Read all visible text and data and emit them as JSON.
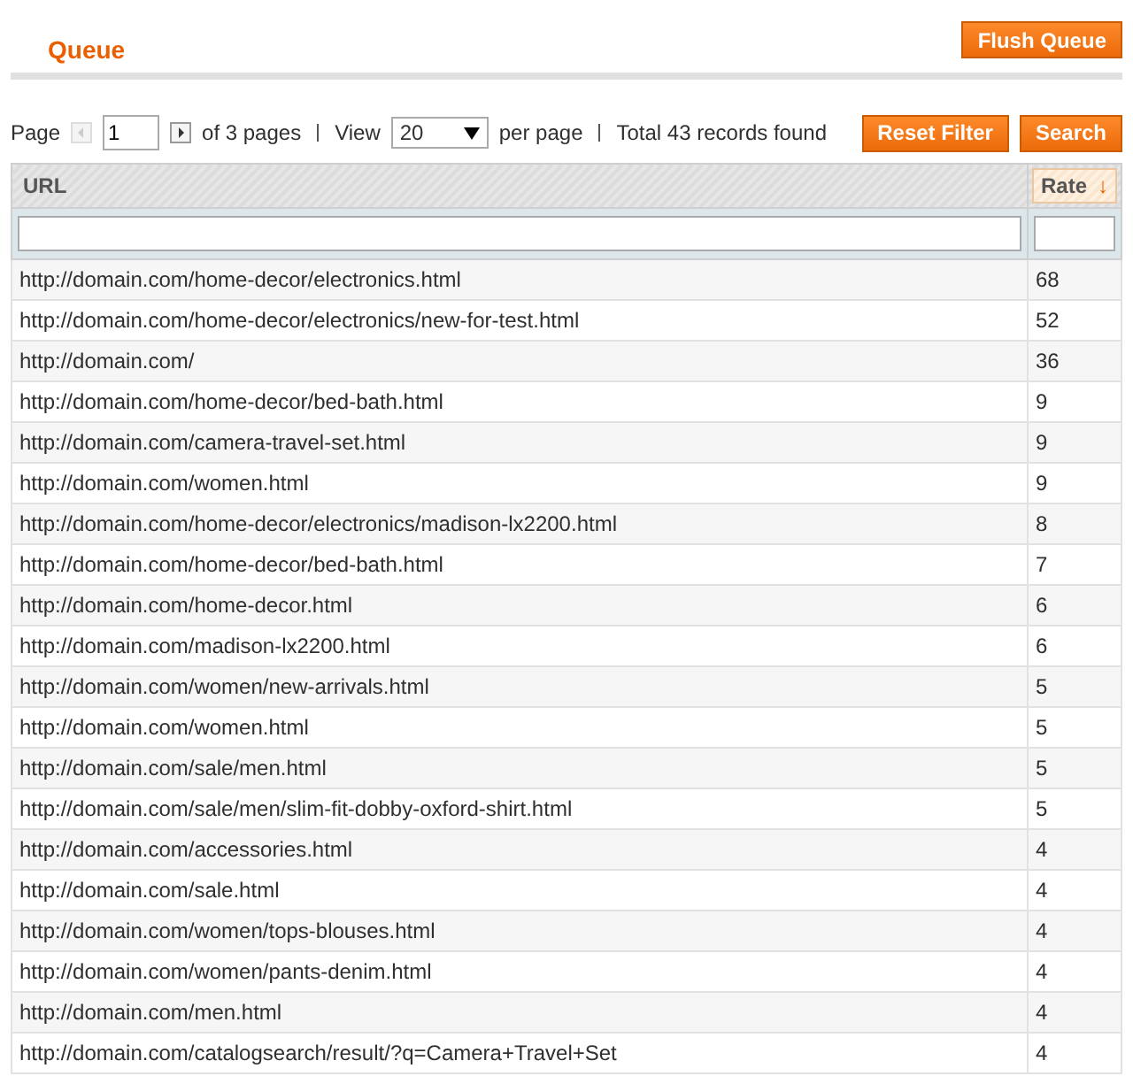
{
  "header": {
    "title": "Queue",
    "action": "Flush Queue"
  },
  "pager": {
    "page_label": "Page",
    "page": "1",
    "of_pages": "of 3 pages",
    "view_label": "View",
    "per_page": "20",
    "per_page_label": "per page",
    "total": "Total 43 records found",
    "buttons": [
      "Reset Filter",
      "Search"
    ]
  },
  "table": {
    "columns": [
      {
        "label": "URL",
        "sorted": false
      },
      {
        "label": "Rate",
        "sorted": true,
        "sort_arrow": "↓"
      }
    ],
    "rows": [
      [
        "http://domain.com/home-decor/electronics.html",
        "68"
      ],
      [
        "http://domain.com/home-decor/electronics/new-for-test.html",
        "52"
      ],
      [
        "http://domain.com/",
        "36"
      ],
      [
        "http://domain.com/home-decor/bed-bath.html",
        "9"
      ],
      [
        "http://domain.com/camera-travel-set.html",
        "9"
      ],
      [
        "http://domain.com/women.html",
        "9"
      ],
      [
        "http://domain.com/home-decor/electronics/madison-lx2200.html",
        "8"
      ],
      [
        "http://domain.com/home-decor/bed-bath.html",
        "7"
      ],
      [
        "http://domain.com/home-decor.html",
        "6"
      ],
      [
        "http://domain.com/madison-lx2200.html",
        "6"
      ],
      [
        "http://domain.com/women/new-arrivals.html",
        "5"
      ],
      [
        "http://domain.com/women.html",
        "5"
      ],
      [
        "http://domain.com/sale/men.html",
        "5"
      ],
      [
        "http://domain.com/sale/men/slim-fit-dobby-oxford-shirt.html",
        "5"
      ],
      [
        "http://domain.com/accessories.html",
        "4"
      ],
      [
        "http://domain.com/sale.html",
        "4"
      ],
      [
        "http://domain.com/women/tops-blouses.html",
        "4"
      ],
      [
        "http://domain.com/women/pants-denim.html",
        "4"
      ],
      [
        "http://domain.com/men.html",
        "4"
      ],
      [
        "http://domain.com/catalogsearch/result/?q=Camera+Travel+Set",
        "4"
      ]
    ]
  }
}
